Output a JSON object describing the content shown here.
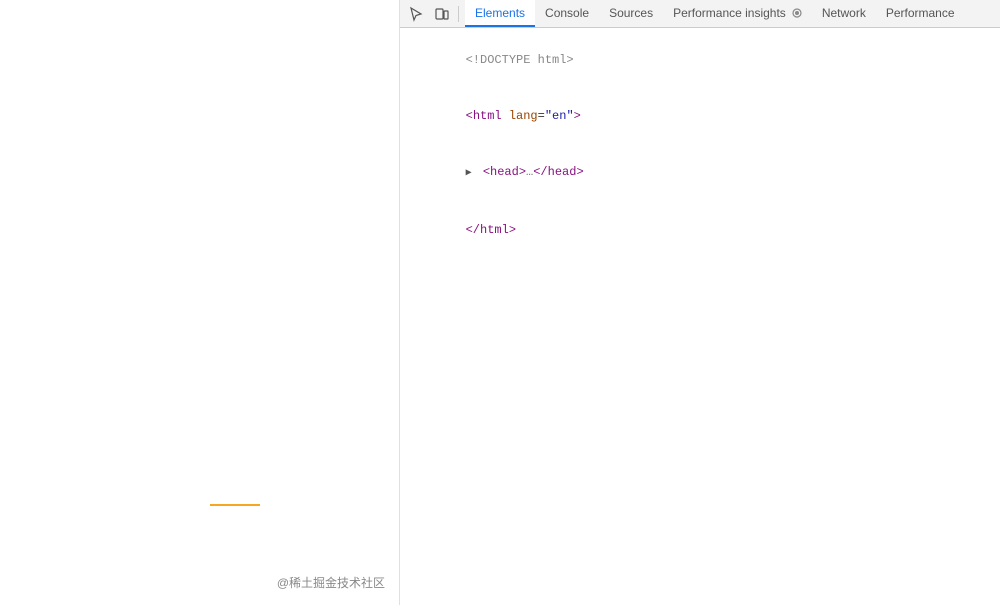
{
  "tabs": [
    {
      "id": "elements",
      "label": "Elements",
      "active": true
    },
    {
      "id": "console",
      "label": "Console",
      "active": false
    },
    {
      "id": "sources",
      "label": "Sources",
      "active": false
    },
    {
      "id": "performance-insights",
      "label": "Performance insights",
      "active": false,
      "hasIcon": true
    },
    {
      "id": "network",
      "label": "Network",
      "active": false
    },
    {
      "id": "performance",
      "label": "Performance",
      "active": false
    }
  ],
  "html_lines": [
    {
      "id": "doctype",
      "type": "doctype",
      "text": "<!DOCTYPE html>"
    },
    {
      "id": "html-open",
      "type": "html-open",
      "tagStart": "<html ",
      "attrName": "lang",
      "attrValue": "\"en\"",
      "tagEnd": ">"
    },
    {
      "id": "head",
      "type": "head",
      "triangle": "▶",
      "text": " <head>…</head>"
    },
    {
      "id": "html-close",
      "type": "html-close",
      "text": "</html>"
    }
  ],
  "watermark": "@稀土掘金技术社区",
  "colors": {
    "active_tab_border": "#1a73e8",
    "active_tab_text": "#1a73e8",
    "tab_bg": "#f3f3f3",
    "yellow_line": "#f5a623"
  }
}
